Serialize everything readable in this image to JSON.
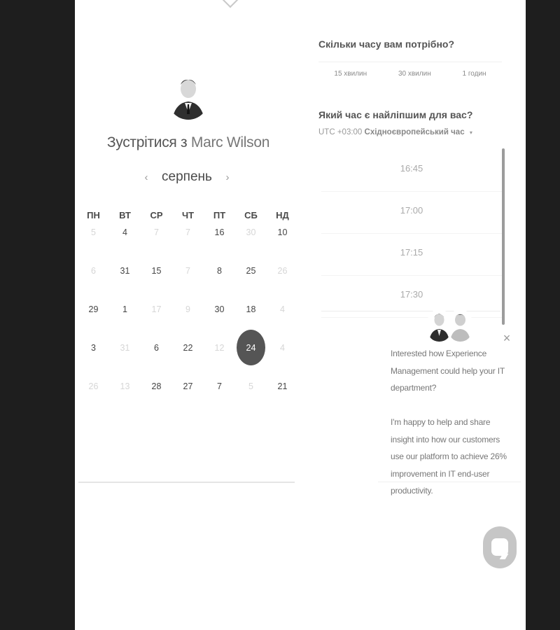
{
  "booking": {
    "title_prefix": "Зустрітися з",
    "host_name": "Marc Wilson",
    "calendar": {
      "month": "серпень",
      "prev_arrow": "‹",
      "next_arrow": "›",
      "weekdays": [
        "ПН",
        "ВТ",
        "СР",
        "ЧТ",
        "ПТ",
        "СБ",
        "НД"
      ],
      "weeks": [
        [
          "5",
          "4",
          "7",
          "7",
          "16",
          "30",
          "10"
        ],
        [
          "6",
          "31",
          "15",
          "7",
          "8",
          "25",
          "26"
        ],
        [
          "29",
          "1",
          "17",
          "9",
          "30",
          "18",
          "4"
        ],
        [
          "3",
          "31",
          "6",
          "22",
          "12",
          "24",
          "4"
        ],
        [
          "26",
          "13",
          "28",
          "27",
          "7",
          "5",
          "21"
        ]
      ],
      "selected_day": "24"
    },
    "duration": {
      "question": "Скільки часу вам потрібно?",
      "options": [
        "15 хвилин",
        "30 хвилин",
        "1 годин"
      ]
    },
    "time": {
      "question": "Який час є найліпшим для вас?",
      "tz_offset": "UTC +03:00",
      "tz_name": "Східноєвропейський час",
      "tz_caret": "▾",
      "slots": [
        "16:45",
        "17:00",
        "17:15",
        "17:30"
      ]
    }
  },
  "chat": {
    "close": "×",
    "message_1": "Interested how Experience Management could help your IT department?",
    "message_2": "I'm happy to help and share insight into how our customers use our platform to achieve 26% improvement in IT end-user productivity."
  },
  "colors": {
    "background": "#1e1e1e",
    "page": "#ffffff",
    "selected_day": "#555555",
    "chat_button": "#c6c6c6"
  },
  "icons": {
    "avatar": "host-avatar",
    "chat_avatars": [
      "agent-avatar-1",
      "agent-avatar-2"
    ],
    "chat_launcher": "chat-bubble-icon"
  }
}
